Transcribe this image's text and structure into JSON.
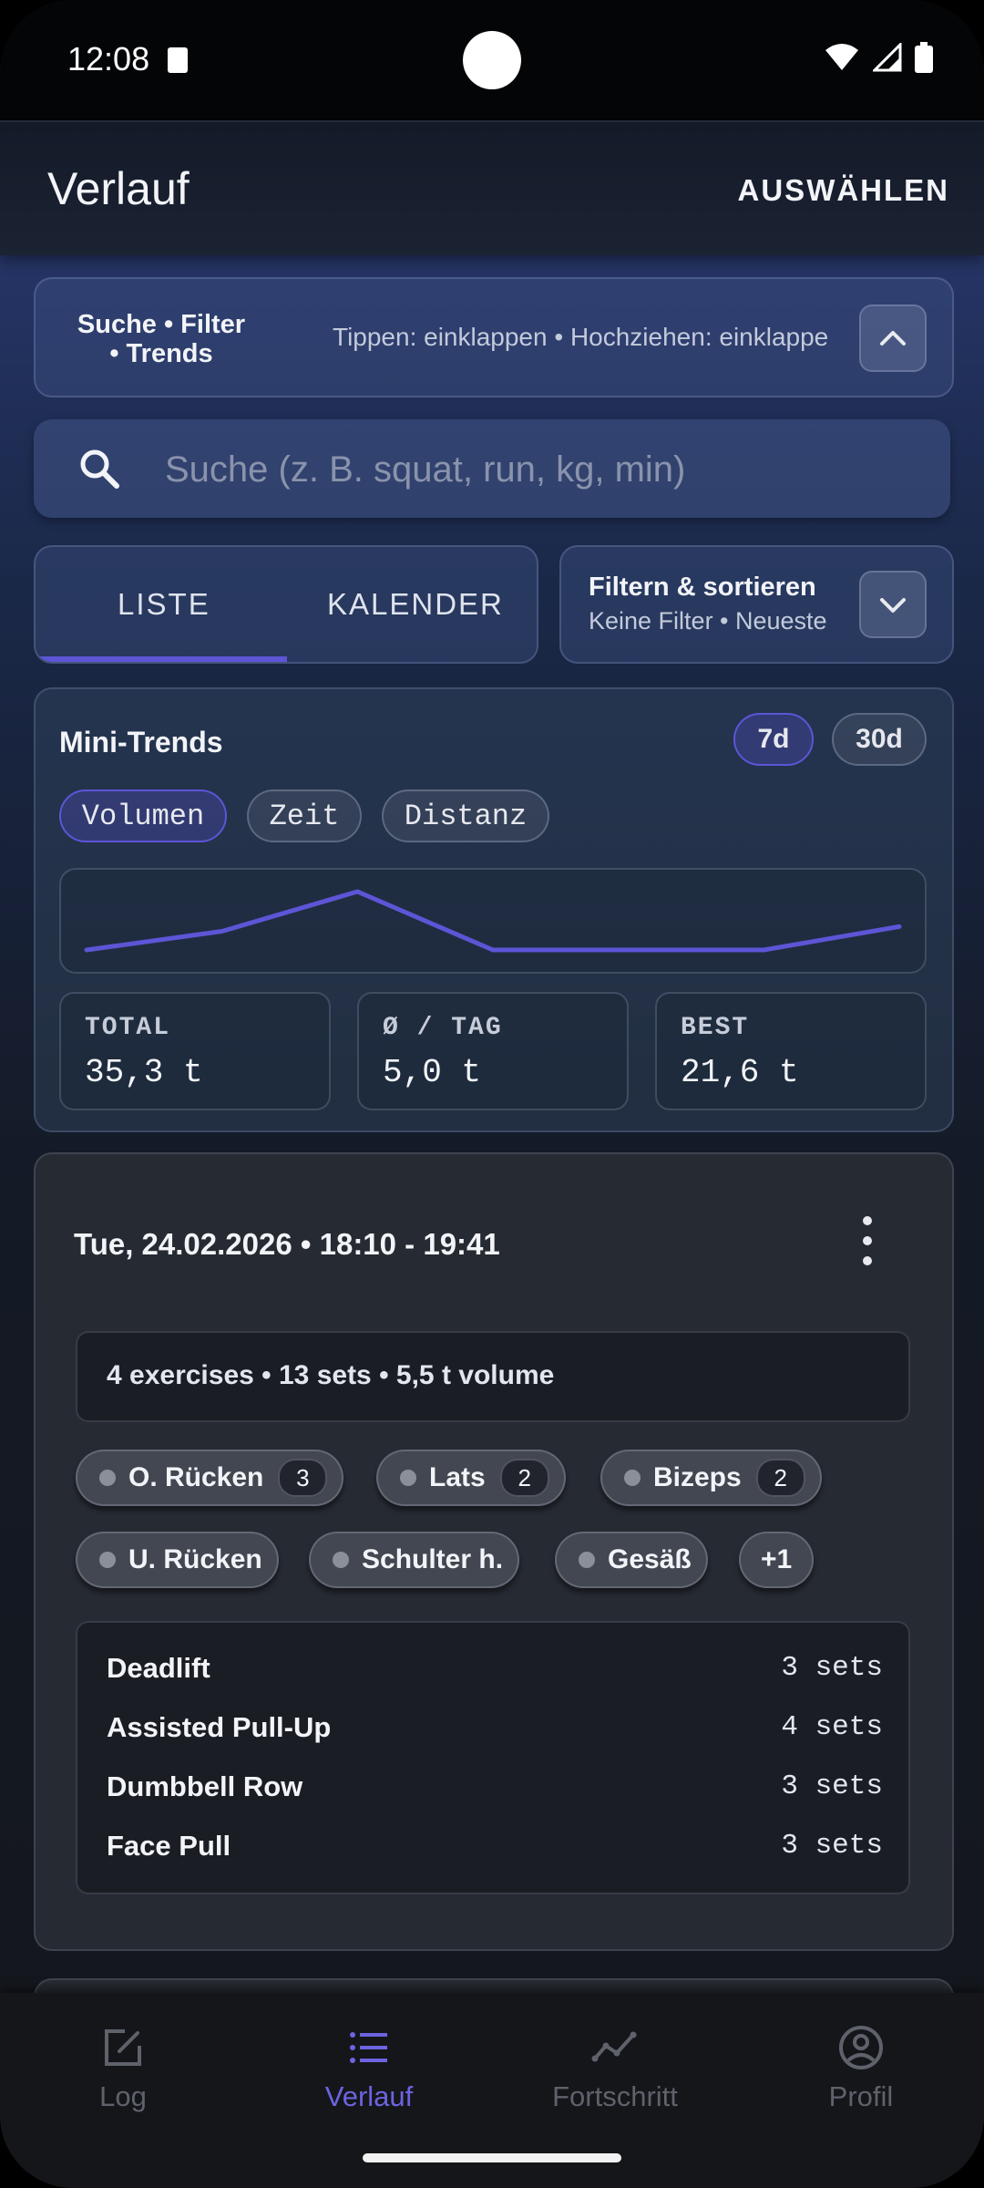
{
  "status_bar": {
    "time": "12:08"
  },
  "app_bar": {
    "title": "Verlauf",
    "select_label": "AUSWÄHLEN"
  },
  "panel": {
    "title": "Suche • Filter • Trends",
    "hint": "Tippen: einklappen • Hochziehen: einklappe"
  },
  "search": {
    "placeholder": "Suche (z. B. squat, run, kg, min)"
  },
  "tabs": {
    "list": "LISTE",
    "calendar": "KALENDER",
    "selected": "LISTE"
  },
  "filter": {
    "title": "Filtern & sortieren",
    "subtitle": "Keine Filter • Neueste"
  },
  "mini_trends": {
    "title": "Mini-Trends",
    "ranges": [
      "7d",
      "30d"
    ],
    "selected_range": "7d",
    "metrics": [
      "Volumen",
      "Zeit",
      "Distanz"
    ],
    "selected_metric": "Volumen",
    "accent_color": "#5d55d6",
    "sparkline_values": [
      0.0,
      0.4,
      1.25,
      0.0,
      0.0,
      0.0,
      0.5
    ],
    "stats": [
      {
        "label": "TOTAL",
        "value": "35,3 t"
      },
      {
        "label": "Ø / TAG",
        "value": "5,0 t"
      },
      {
        "label": "BEST",
        "value": "21,6 t"
      }
    ]
  },
  "workout": {
    "date": "Tue, 24.02.2026 • 18:10 - 19:41",
    "summary": "4 exercises • 13 sets • 5,5 t volume",
    "muscles": [
      {
        "name": "O. Rücken",
        "count": "3"
      },
      {
        "name": "Lats",
        "count": "2"
      },
      {
        "name": "Bizeps",
        "count": "2"
      },
      {
        "name": "U. Rücken",
        "count": ""
      },
      {
        "name": "Schulter h.",
        "count": ""
      },
      {
        "name": "Gesäß",
        "count": ""
      }
    ],
    "more_muscles": "+1",
    "exercises": [
      {
        "name": "Deadlift",
        "sets": "3 sets"
      },
      {
        "name": "Assisted Pull-Up",
        "sets": "4 sets"
      },
      {
        "name": "Dumbbell Row",
        "sets": "3 sets"
      },
      {
        "name": "Face Pull",
        "sets": "3 sets"
      }
    ]
  },
  "bottom_nav": {
    "items": [
      {
        "label": "Log",
        "icon": "edit-icon"
      },
      {
        "label": "Verlauf",
        "icon": "list-icon"
      },
      {
        "label": "Fortschritt",
        "icon": "trend-icon"
      },
      {
        "label": "Profil",
        "icon": "profile-icon"
      }
    ],
    "active": "Verlauf"
  }
}
